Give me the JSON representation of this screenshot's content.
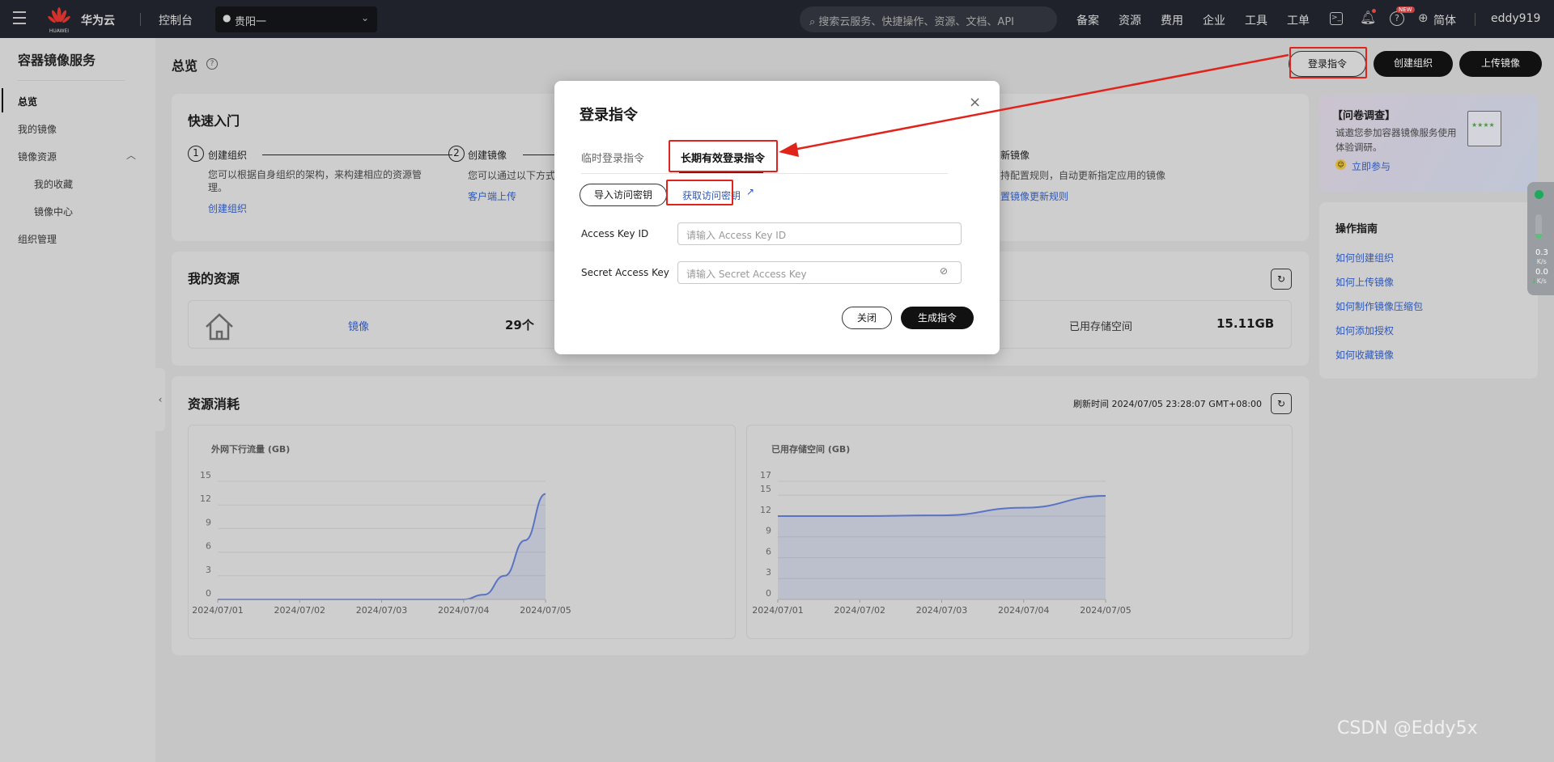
{
  "topbar": {
    "menu_icon": "hamburger-icon",
    "brand": "华为云",
    "brand_logo_text": "HUAWEI",
    "console": "控制台",
    "region": "贵阳一",
    "search_placeholder": "搜索云服务、快捷操作、资源、文档、API",
    "nav": [
      "备案",
      "资源",
      "费用",
      "企业",
      "工具",
      "工单"
    ],
    "badge_new": "NEW",
    "language": "简体",
    "user": "eddy919"
  },
  "sidebar": {
    "title": "容器镜像服务",
    "items": [
      {
        "label": "总览",
        "active": true
      },
      {
        "label": "我的镜像"
      },
      {
        "label": "镜像资源",
        "expanded": true
      },
      {
        "label": "我的收藏",
        "sub": true
      },
      {
        "label": "镜像中心",
        "sub": true
      },
      {
        "label": "组织管理"
      }
    ]
  },
  "header": {
    "title": "总览",
    "buttons": {
      "login": "登录指令",
      "create_org": "创建组织",
      "upload": "上传镜像"
    }
  },
  "quickstart": {
    "title": "快速入门",
    "steps": [
      {
        "num": "1",
        "title": "创建组织",
        "desc": "您可以根据自身组织的架构，来构建相应的资源管理。",
        "link": "创建组织"
      },
      {
        "num": "2",
        "title": "创建镜像",
        "desc": "您可以通过以下方式",
        "link": "客户端上传"
      },
      {
        "num": "",
        "title": "新镜像",
        "desc": "持配置规则，自动更新指定应用的镜像",
        "link": "置镜像更新规则"
      }
    ]
  },
  "resources": {
    "title": "我的资源",
    "image_label": "镜像",
    "image_count": "29个",
    "storage_label": "已用存储空间",
    "storage_value": "15.11GB"
  },
  "consumption": {
    "title": "资源消耗",
    "refresh_time": "刷新时间 2024/07/05 23:28:07 GMT+08:00"
  },
  "chart_data": [
    {
      "type": "area",
      "title": "外网下行流量 (GB)",
      "x": [
        "2024/07/01",
        "2024/07/02",
        "2024/07/03",
        "2024/07/04",
        "2024/07/04 06:00",
        "2024/07/04 12:00",
        "2024/07/04 18:00",
        "2024/07/05"
      ],
      "values": [
        0,
        0,
        0,
        0,
        0.6,
        3.0,
        7.5,
        13.4
      ],
      "xticks": [
        "2024/07/01",
        "2024/07/02",
        "2024/07/03",
        "2024/07/04",
        "2024/07/05"
      ],
      "yticks": [
        0,
        3,
        6,
        9,
        12,
        15
      ],
      "ylim": [
        0,
        15
      ],
      "grid": true,
      "color": "#5a73c4"
    },
    {
      "type": "area",
      "title": "已用存储空间 (GB)",
      "x": [
        "2024/07/01",
        "2024/07/02",
        "2024/07/03",
        "2024/07/04",
        "2024/07/05"
      ],
      "values": [
        12.0,
        12.0,
        12.1,
        13.2,
        14.9
      ],
      "xticks": [
        "2024/07/01",
        "2024/07/02",
        "2024/07/03",
        "2024/07/04",
        "2024/07/05"
      ],
      "yticks": [
        0,
        3,
        6,
        9,
        12,
        15,
        17
      ],
      "ylim": [
        0,
        17
      ],
      "grid": true,
      "color": "#5a73c4"
    }
  ],
  "survey": {
    "title": "【问卷调查】",
    "desc": "诚邀您参加容器镜像服务使用体验调研。",
    "link": "立即参与"
  },
  "guide": {
    "title": "操作指南",
    "links": [
      "如何创建组织",
      "如何上传镜像",
      "如何制作镜像压缩包",
      "如何添加授权",
      "如何收藏镜像"
    ]
  },
  "netmon": {
    "up": "0.3",
    "down": "0.0",
    "unit": "K/s"
  },
  "modal": {
    "title": "登录指令",
    "tabs": [
      "临时登录指令",
      "长期有效登录指令"
    ],
    "active_tab": 1,
    "import_btn": "导入访问密钥",
    "get_key_link": "获取访问密钥",
    "ak_label": "Access Key ID",
    "ak_placeholder": "请输入 Access Key ID",
    "sk_label": "Secret Access Key",
    "sk_placeholder": "请输入 Secret Access Key",
    "close_btn": "关闭",
    "generate_btn": "生成指令"
  },
  "watermark": "CSDN @Eddy5x",
  "colors": {
    "annotation": "#e0231b",
    "link": "#2f58b8",
    "series": "#5a73c4"
  }
}
